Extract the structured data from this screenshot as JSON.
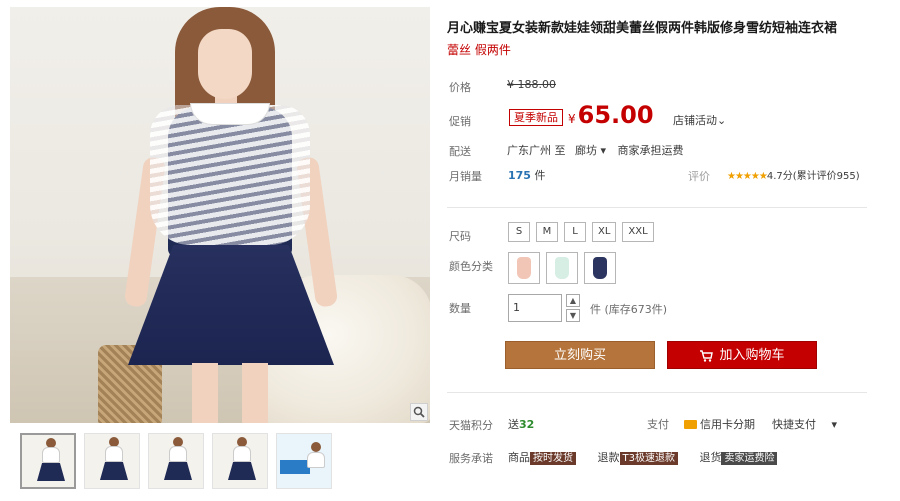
{
  "gallery": {
    "zoom_icon": "magnifier-icon",
    "thumbnails": [
      {
        "kind": "dress"
      },
      {
        "kind": "dress"
      },
      {
        "kind": "dress"
      },
      {
        "kind": "dress"
      },
      {
        "kind": "ad"
      }
    ]
  },
  "product": {
    "title": "月心赚宝夏女装新款娃娃领甜美蕾丝假两件韩版修身雪纺短袖连衣裙",
    "subtitle": "蕾丝 假两件"
  },
  "price": {
    "label": "价格",
    "original": "¥ 188.00"
  },
  "promo": {
    "label": "促销",
    "badge": "夏季新品",
    "currency": "¥",
    "price": "65.00",
    "shop_activity": "店铺活动"
  },
  "delivery": {
    "label": "配送",
    "origin": "广东广州 至",
    "destination": "廊坊",
    "freight": "商家承担运费"
  },
  "sales": {
    "label": "月销量",
    "count": "175",
    "unit": "件",
    "rating_label": "评价",
    "stars": "★★★★★",
    "rating_text": "4.7分(累计评价955)"
  },
  "size": {
    "label": "尺码",
    "options": [
      "S",
      "M",
      "L",
      "XL",
      "XXL"
    ]
  },
  "color": {
    "label": "颜色分类",
    "swatches": [
      "#f2c6b6",
      "#d6eee4",
      "#2b3560"
    ]
  },
  "quantity": {
    "label": "数量",
    "value": "1",
    "up": "▲",
    "down": "▼",
    "stock": "件 (库存673件)"
  },
  "actions": {
    "buy_now": "立刻购买",
    "add_cart": "加入购物车"
  },
  "points": {
    "label": "天猫积分",
    "prefix": "送",
    "value": "32"
  },
  "payment": {
    "label": "支付",
    "card": "信用卡分期",
    "quick": "快捷支付"
  },
  "service": {
    "label": "服务承诺",
    "goods": "商品",
    "goods_tag": "按时发货",
    "refund": "退款",
    "refund_tag": "T3极速退款",
    "return": "退货",
    "return_tag": "卖家运费险"
  }
}
